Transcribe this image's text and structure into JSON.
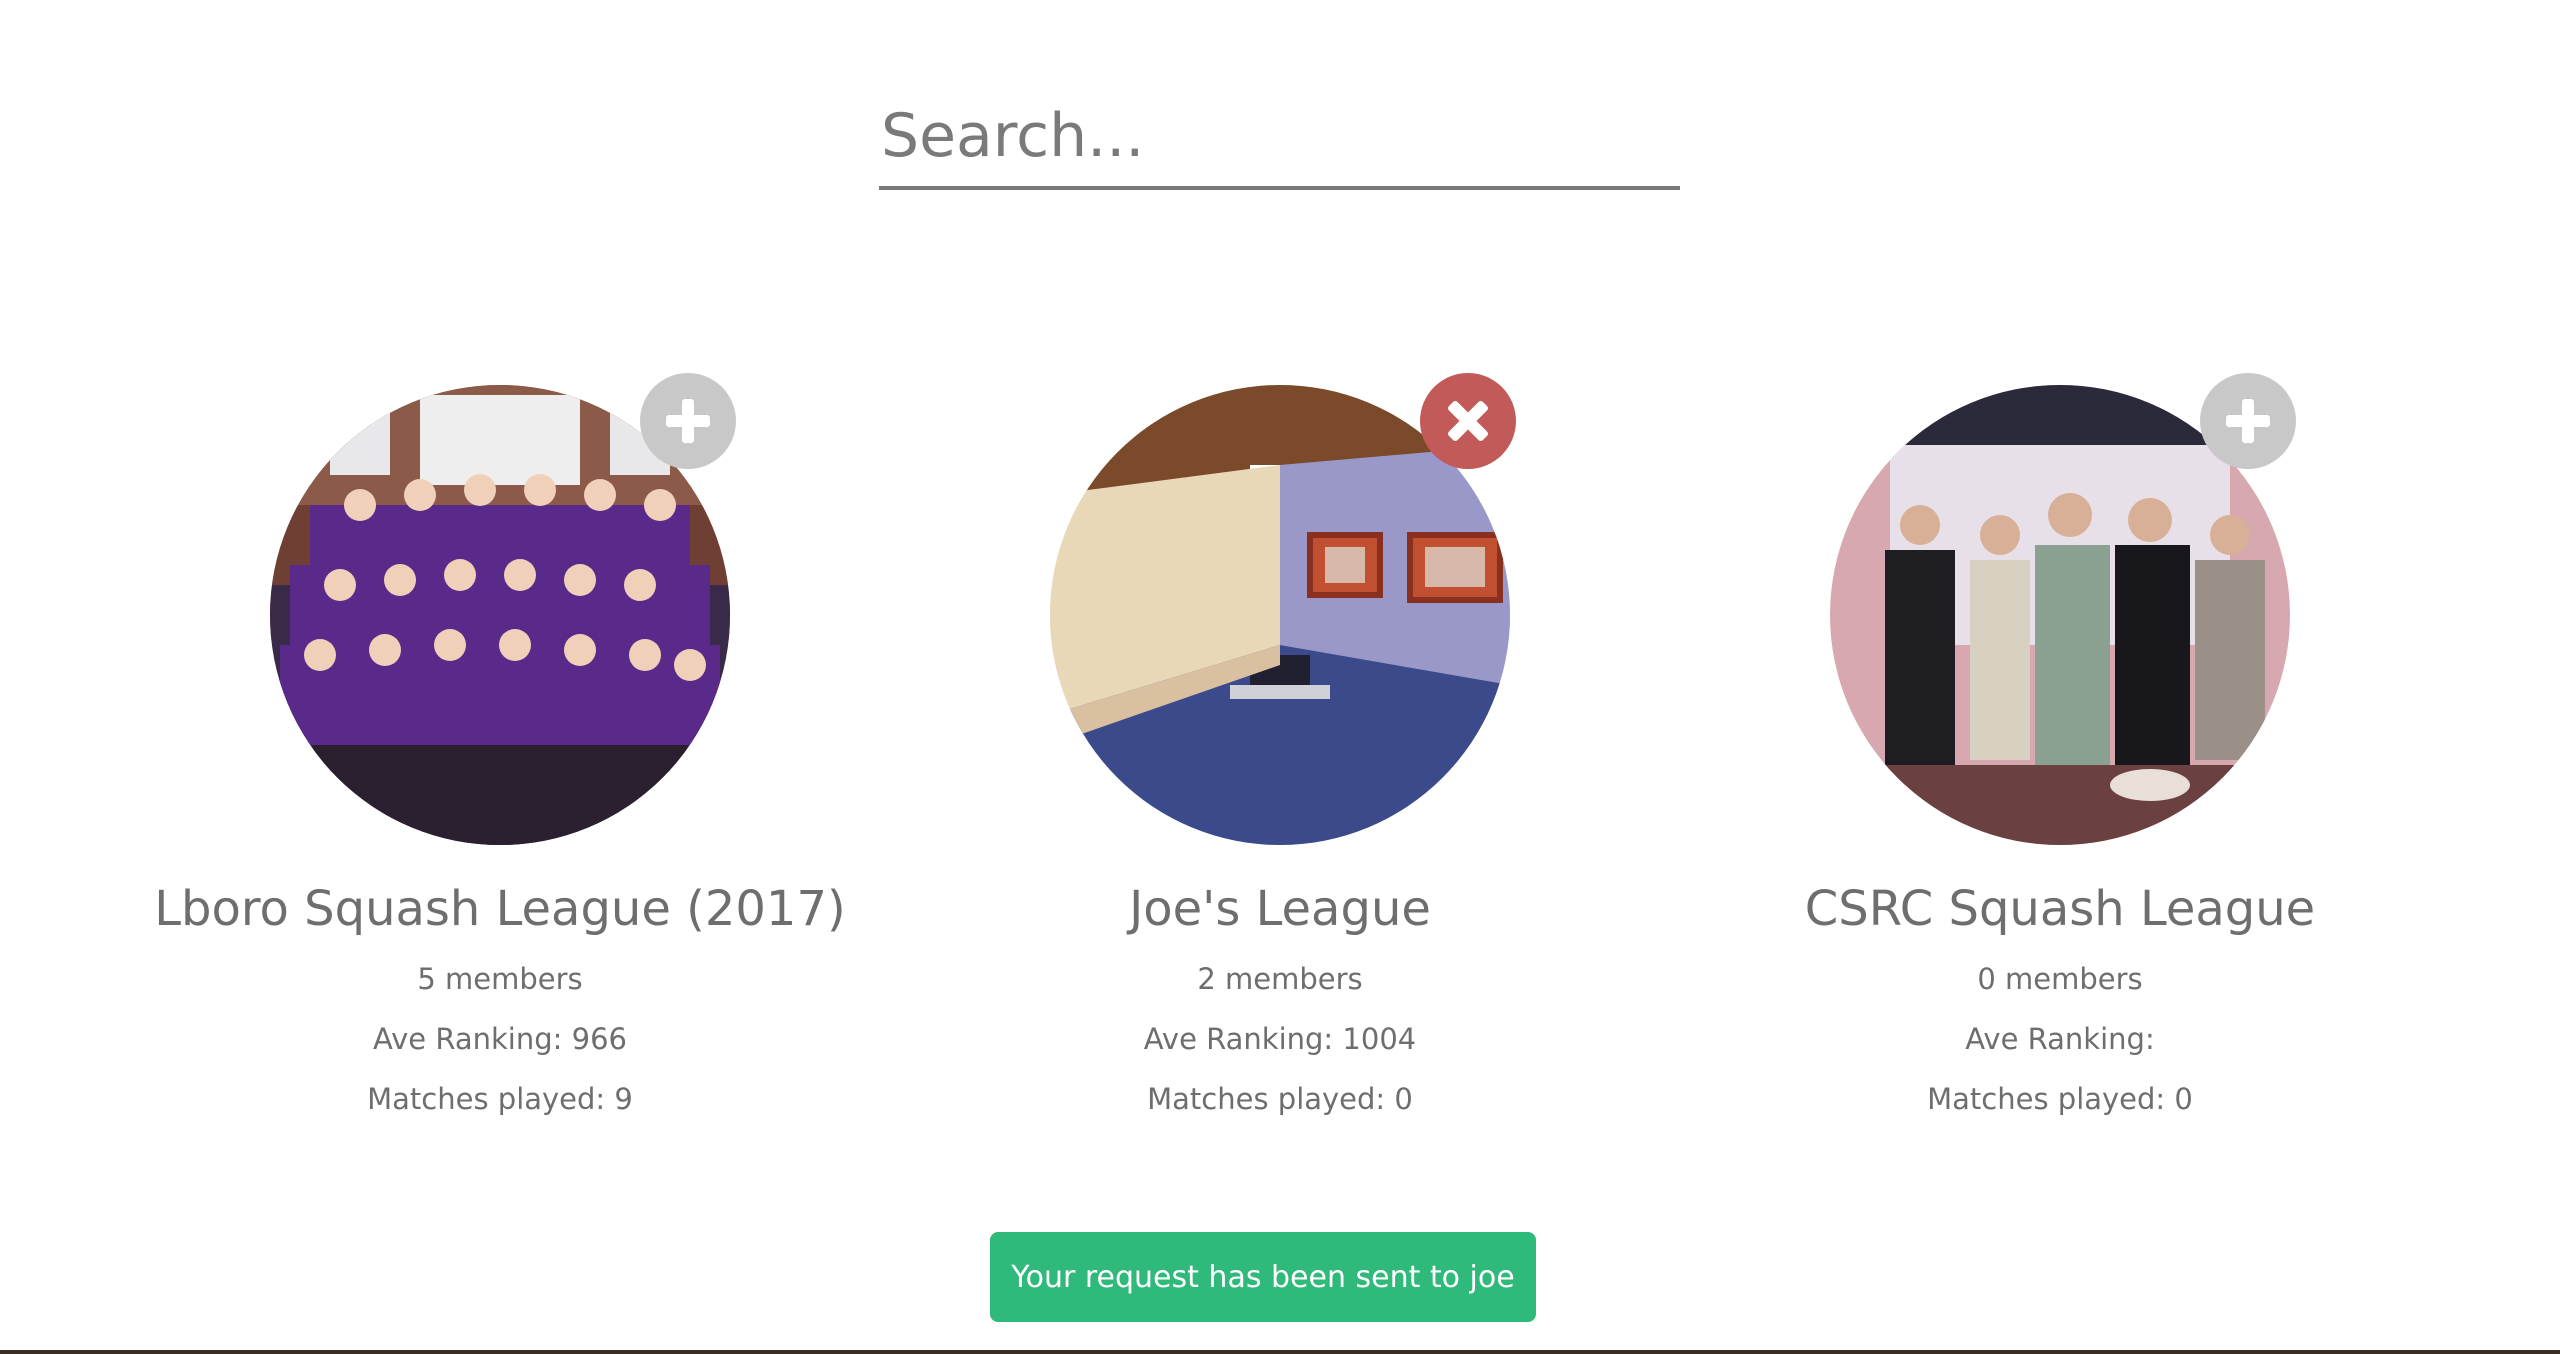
{
  "search": {
    "placeholder": "Search..."
  },
  "leagues": [
    {
      "name": "Lboro Squash League (2017)",
      "members": "5 members",
      "ave_ranking": "Ave Ranking: 966",
      "matches": "Matches played: 9",
      "action": "join",
      "action_icon": "plus-icon"
    },
    {
      "name": "Joe's League",
      "members": "2 members",
      "ave_ranking": "Ave Ranking: 1004",
      "matches": "Matches played: 0",
      "action": "leave",
      "action_icon": "close-icon"
    },
    {
      "name": "CSRC Squash League",
      "members": "0 members",
      "ave_ranking": "Ave Ranking:",
      "matches": "Matches played: 0",
      "action": "join",
      "action_icon": "plus-icon"
    }
  ],
  "toast": {
    "message": "Your request has been sent to joe"
  },
  "colors": {
    "join_button": "#c8c8c8",
    "leave_button": "#c25a5a",
    "toast_bg": "#2fb97a",
    "text": "#6e6e6e"
  }
}
